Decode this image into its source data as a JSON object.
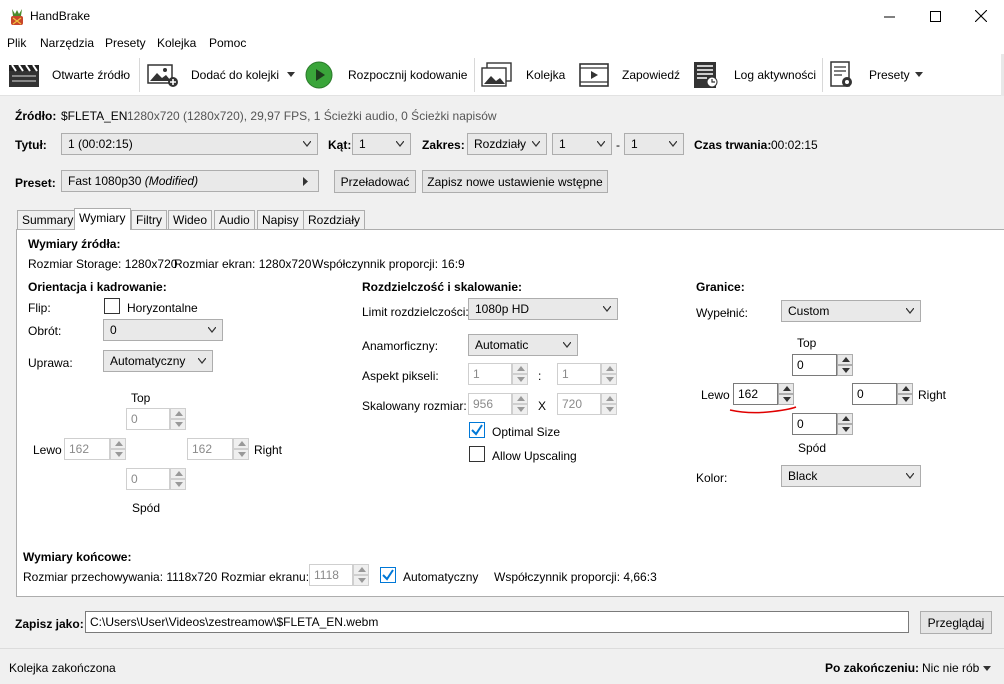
{
  "window": {
    "title": "HandBrake"
  },
  "menu": [
    "Plik",
    "Narzędzia",
    "Presety",
    "Kolejka",
    "Pomoc"
  ],
  "toolbar": {
    "open_source": "Otwarte źródło",
    "add_queue": "Dodać do kolejki",
    "start": "Rozpocznij kodowanie",
    "queue": "Kolejka",
    "preview": "Zapowiedź",
    "activity_log": "Log aktywności",
    "presets": "Presety"
  },
  "source": {
    "label": "Źródło:",
    "name": "$FLETA_EN",
    "info": "1280x720 (1280x720), 29,97 FPS, 1 Ścieżki audio, 0 Ścieżki napisów"
  },
  "title_row": {
    "title_label": "Tytuł:",
    "title_value": "1 (00:02:15)",
    "angle_label": "Kąt:",
    "angle_value": "1",
    "range_label": "Zakres:",
    "range_mode": "Rozdziały",
    "range_start": "1",
    "range_dash": "-",
    "range_end": "1",
    "duration_label": "Czas trwania:",
    "duration_value": "00:02:15"
  },
  "preset_row": {
    "label": "Preset:",
    "value": "Fast 1080p30",
    "modified": "(Modified)",
    "reload": "Przeładować",
    "save_new": "Zapisz nowe ustawienie wstępne"
  },
  "tabs": [
    "Summary",
    "Wymiary",
    "Filtry",
    "Wideo",
    "Audio",
    "Napisy",
    "Rozdziały"
  ],
  "active_tab": "Wymiary",
  "source_dims": {
    "heading": "Wymiary źródła:",
    "storage": "Rozmiar Storage: 1280x720",
    "display": "Rozmiar ekran: 1280x720",
    "aspect": "Współczynnik proporcji: 16:9"
  },
  "orientation": {
    "heading": "Orientacja i kadrowanie:",
    "flip_label": "Flip:",
    "flip_option": "Horyzontalne",
    "rotate_label": "Obrót:",
    "rotate_value": "0",
    "crop_label": "Uprawa:",
    "crop_value": "Automatyczny",
    "top_label": "Top",
    "top_value": "0",
    "left_label": "Lewo",
    "left_value": "162",
    "right_value": "162",
    "right_label": "Right",
    "bottom_value": "0",
    "bottom_label": "Spód"
  },
  "resolution": {
    "heading": "Rozdzielczość i skalowanie:",
    "limit_label": "Limit rozdzielczości:",
    "limit_value": "1080p HD",
    "anamorphic_label": "Anamorficzny:",
    "anamorphic_value": "Automatic",
    "pixel_aspect_label": "Aspekt pikseli:",
    "pixel_aspect_w": "1",
    "pixel_aspect_sep": ":",
    "pixel_aspect_h": "1",
    "scaled_label": "Skalowany rozmiar:",
    "scaled_w": "956",
    "scaled_sep": "X",
    "scaled_h": "720",
    "optimal_size": "Optimal Size",
    "allow_upscaling": "Allow Upscaling"
  },
  "borders": {
    "heading": "Granice:",
    "fill_label": "Wypełnić:",
    "fill_value": "Custom",
    "top_label": "Top",
    "top_value": "0",
    "left_label": "Lewo",
    "left_value": "162",
    "right_value": "0",
    "right_label": "Right",
    "bottom_value": "0",
    "bottom_label": "Spód",
    "color_label": "Kolor:",
    "color_value": "Black"
  },
  "final_dims": {
    "heading": "Wymiary końcowe:",
    "storage": "Rozmiar przechowywania: 1118x720",
    "display_label": "Rozmiar ekranu:",
    "display_value": "1118",
    "automatic": "Automatyczny",
    "aspect": "Współczynnik proporcji: 4,66:3"
  },
  "save_as": {
    "label": "Zapisz jako:",
    "path": "C:\\Users\\User\\Videos\\zestreamow\\$FLETA_EN.webm",
    "browse": "Przeglądaj"
  },
  "status": {
    "text": "Kolejka zakończona",
    "after_label": "Po zakończeniu:",
    "after_value": "Nic nie rób"
  },
  "colors": {
    "accent": "#0078d7",
    "annotation": "#e00000",
    "play_green": "#3aa53a"
  }
}
